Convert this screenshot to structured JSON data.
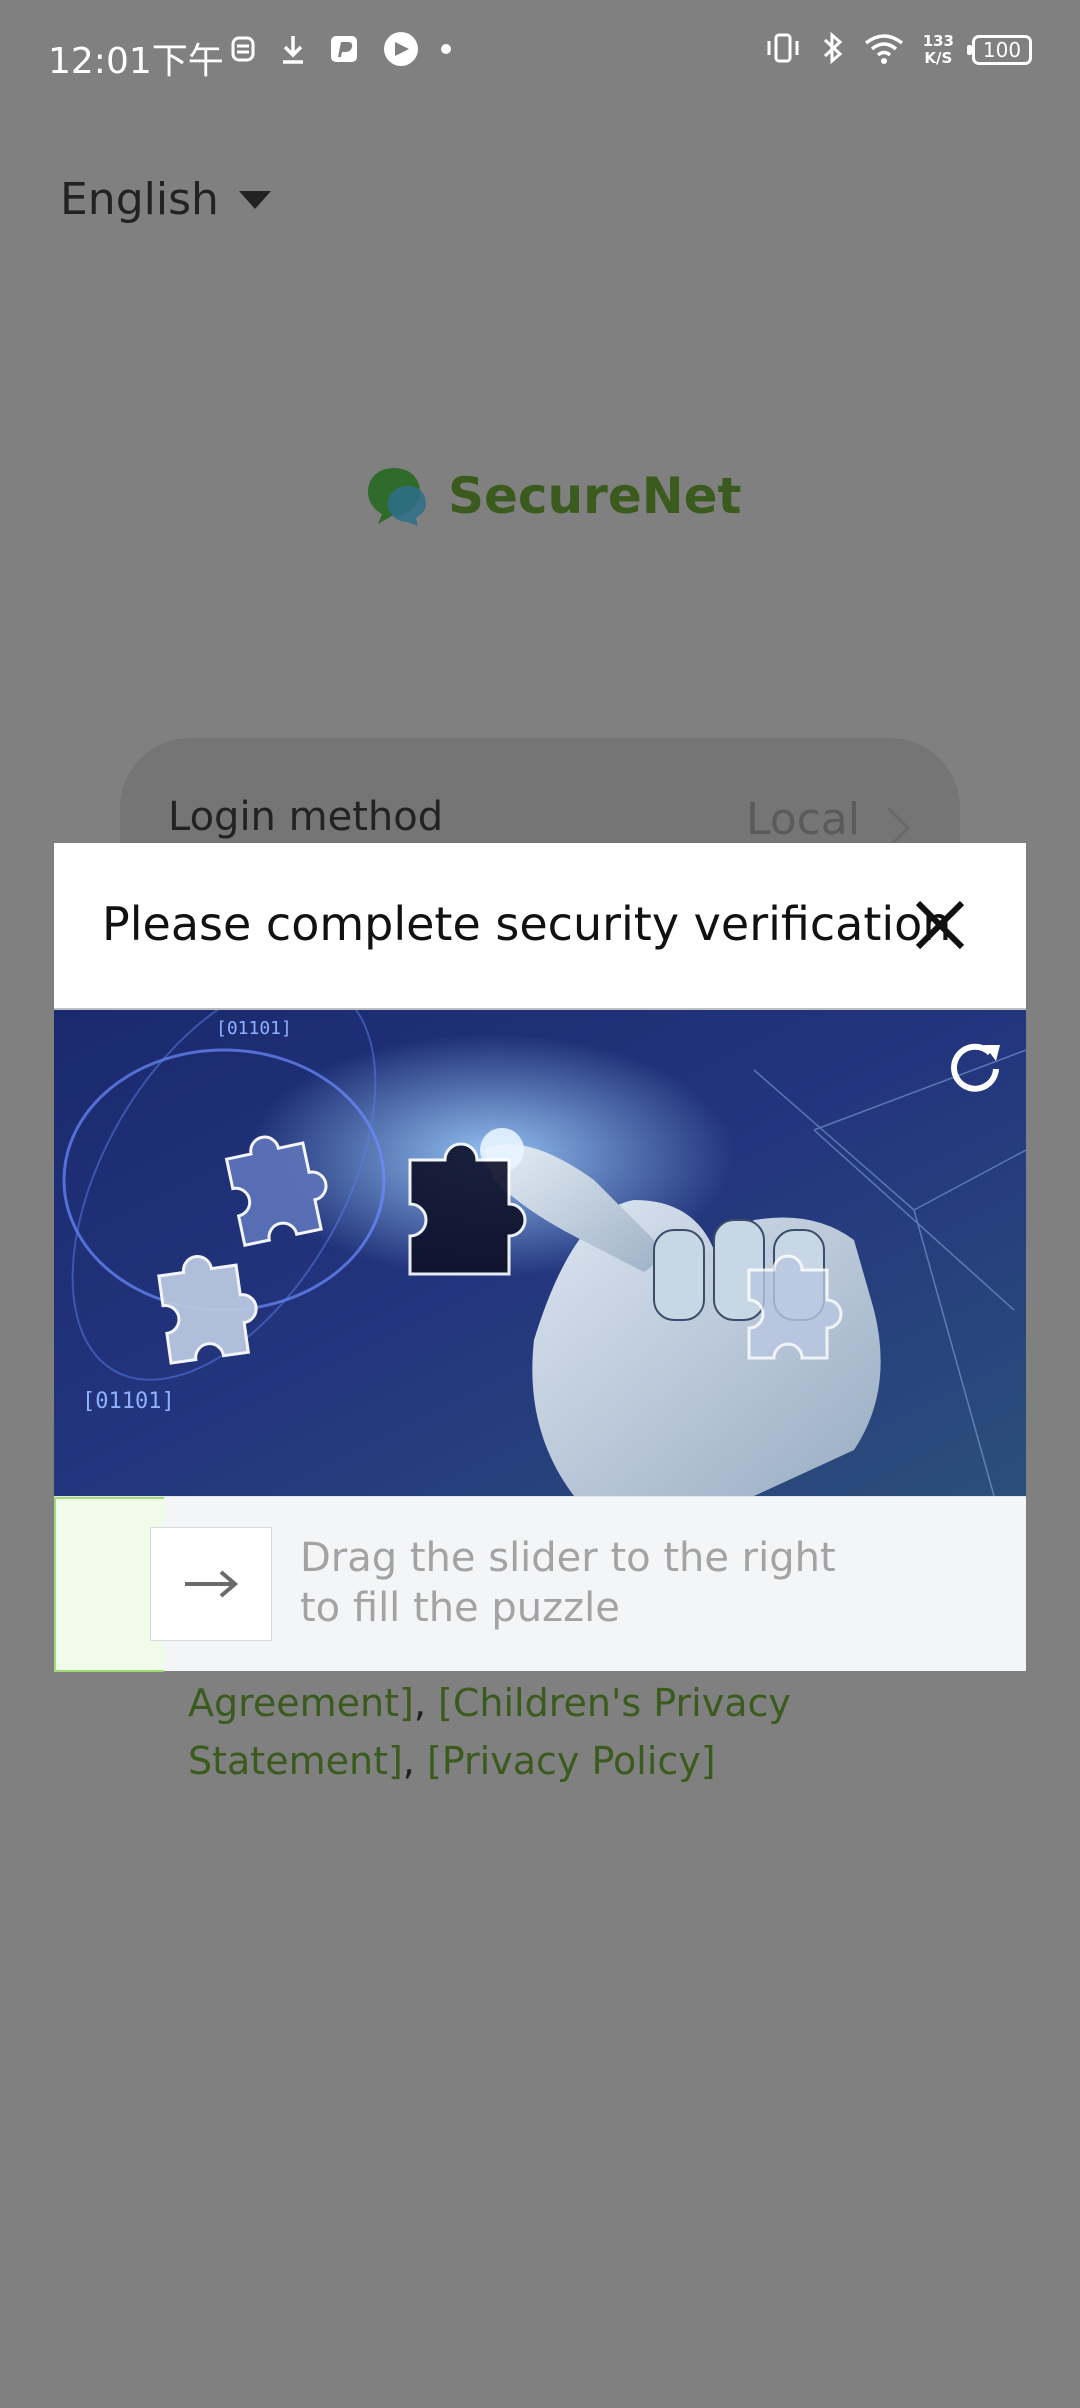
{
  "status_bar": {
    "time": "12:01下午",
    "network_speed_value": "133",
    "network_speed_unit": "K/S",
    "battery": "100",
    "left_icons": [
      "notification-bot-icon",
      "download-icon",
      "paypal-icon",
      "app-circle-icon",
      "more-dot-icon"
    ],
    "right_icons": [
      "vibrate-icon",
      "bluetooth-icon",
      "wifi-icon"
    ]
  },
  "language": {
    "label": "English"
  },
  "brand": {
    "name": "SecureNet",
    "color": "#3a5b1d"
  },
  "login": {
    "label": "Login method",
    "value": "Local"
  },
  "agreement": {
    "line1_link": "Agreement]",
    "sep1": ", ",
    "link2_part1": "[Children's Privacy",
    "link2_part2": "Statement]",
    "sep2": ", ",
    "link3": "[Privacy Policy]"
  },
  "verification": {
    "title": "Please complete security verification",
    "image_text_1": "[01101]",
    "image_text_2": "[01101]",
    "slider_hint": "Drag the slider to the right to fill the puzzle",
    "slider_progress": 0,
    "accent_color": "#9edb75"
  }
}
